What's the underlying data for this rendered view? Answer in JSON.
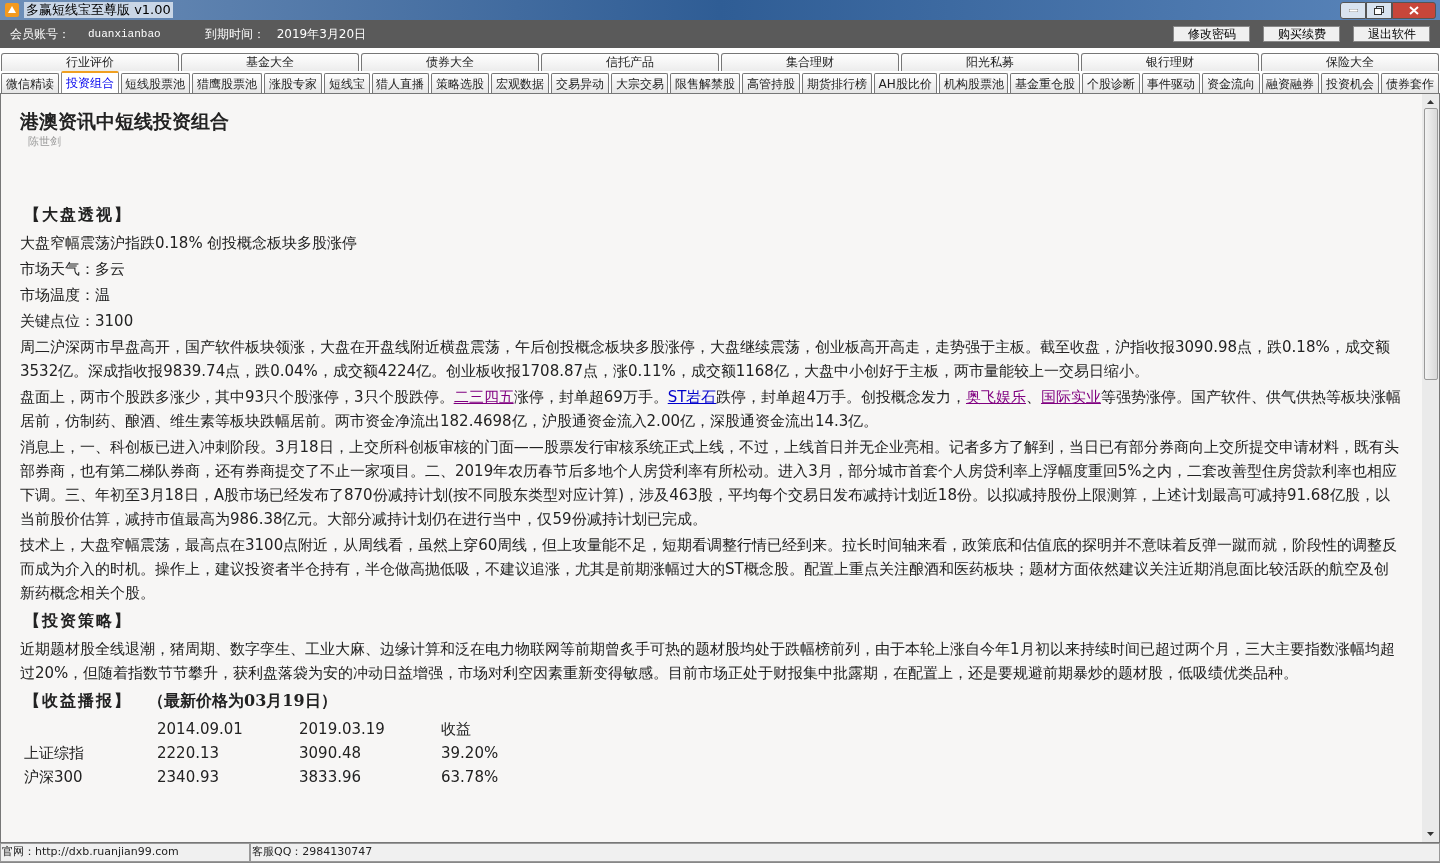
{
  "window": {
    "title": "多赢短线宝至尊版 v1.00"
  },
  "account_bar": {
    "account_label": "会员账号：",
    "account": "duanxianbao",
    "expiry_label": "到期时间：",
    "expiry": "2019年3月20日",
    "buttons": [
      "修改密码",
      "购买续费",
      "退出软件"
    ]
  },
  "categories": [
    "行业评价",
    "基金大全",
    "债券大全",
    "信托产品",
    "集合理财",
    "阳光私募",
    "银行理财",
    "保险大全"
  ],
  "tabs": [
    {
      "label": "微信精读",
      "selected": false
    },
    {
      "label": "投资组合",
      "selected": true
    },
    {
      "label": "短线股票池",
      "selected": false
    },
    {
      "label": "猎鹰股票池",
      "selected": false
    },
    {
      "label": "涨股专家",
      "selected": false
    },
    {
      "label": "短线宝",
      "selected": false
    },
    {
      "label": "猎人直播",
      "selected": false
    },
    {
      "label": "策略选股",
      "selected": false
    },
    {
      "label": "宏观数据",
      "selected": false
    },
    {
      "label": "交易异动",
      "selected": false
    },
    {
      "label": "大宗交易",
      "selected": false
    },
    {
      "label": "限售解禁股",
      "selected": false
    },
    {
      "label": "高管持股",
      "selected": false
    },
    {
      "label": "期货排行榜",
      "selected": false
    },
    {
      "label": "AH股比价",
      "selected": false
    },
    {
      "label": "机构股票池",
      "selected": false
    },
    {
      "label": "基金重仓股",
      "selected": false
    },
    {
      "label": "个股诊断",
      "selected": false
    },
    {
      "label": "事件驱动",
      "selected": false
    },
    {
      "label": "资金流向",
      "selected": false
    },
    {
      "label": "融资融券",
      "selected": false
    },
    {
      "label": "投资机会",
      "selected": false
    },
    {
      "label": "债券套作",
      "selected": false
    }
  ],
  "article": {
    "title": "港澳资讯中短线投资组合",
    "author": "陈世剑",
    "blocks": [
      {
        "kind": "heading",
        "text": "【大盘透视】"
      },
      {
        "kind": "line",
        "text": "大盘窄幅震荡沪指跌0.18% 创投概念板块多股涨停"
      },
      {
        "kind": "line",
        "text": "市场天气：多云"
      },
      {
        "kind": "line",
        "text": "市场温度：温"
      },
      {
        "kind": "line",
        "text": "关键点位：3100"
      },
      {
        "kind": "paragraph",
        "segments": [
          {
            "kind": "text",
            "text": "周二沪深两市早盘高开，国产软件板块领涨，大盘在开盘线附近横盘震荡，午后创投概念板块多股涨停，大盘继续震荡，创业板高开高走，走势强于主板。截至收盘，沪指收报3090.98点，跌0.18%，成交额3532亿。深成指收报9839.74点，跌0.04%，成交额4224亿。创业板收报1708.87点，涨0.11%，成交额1168亿，大盘中小创好于主板，两市量能较上一交易日缩小。"
          }
        ]
      },
      {
        "kind": "paragraph",
        "segments": [
          {
            "kind": "text",
            "text": "盘面上，两市个股跌多涨少，其中93只个股涨停，3只个股跌停。"
          },
          {
            "kind": "link",
            "text": "二三四五",
            "visited": true
          },
          {
            "kind": "text",
            "text": "涨停，封单超69万手。"
          },
          {
            "kind": "link",
            "text": "ST岩石",
            "visited": false
          },
          {
            "kind": "text",
            "text": "跌停，封单超4万手。创投概念发力，"
          },
          {
            "kind": "link",
            "text": "奥飞娱乐",
            "visited": true
          },
          {
            "kind": "text",
            "text": "、"
          },
          {
            "kind": "link",
            "text": "国际实业",
            "visited": true
          },
          {
            "kind": "text",
            "text": "等强势涨停。国产软件、供气供热等板块涨幅居前，仿制药、酿酒、维生素等板块跌幅居前。两市资金净流出182.4698亿，沪股通资金流入2.00亿，深股通资金流出14.3亿。"
          }
        ]
      },
      {
        "kind": "paragraph",
        "segments": [
          {
            "kind": "text",
            "text": "消息上，一、科创板已进入冲刺阶段。3月18日，上交所科创板审核的门面——股票发行审核系统正式上线，不过，上线首日并无企业亮相。记者多方了解到，当日已有部分券商向上交所提交申请材料，既有头部券商，也有第二梯队券商，还有券商提交了不止一家项目。二、2019年农历春节后多地个人房贷利率有所松动。进入3月，部分城市首套个人房贷利率上浮幅度重回5%之内，二套改善型住房贷款利率也相应下调。三、年初至3月18日，A股市场已经发布了870份减持计划(按不同股东类型对应计算)，涉及463股，平均每个交易日发布减持计划近18份。以拟减持股份上限测算，上述计划最高可减持91.68亿股，以当前股价估算，减持市值最高为986.38亿元。大部分减持计划仍在进行当中，仅59份减持计划已完成。"
          }
        ]
      },
      {
        "kind": "paragraph",
        "segments": [
          {
            "kind": "text",
            "text": "技术上，大盘窄幅震荡，最高点在3100点附近，从周线看，虽然上穿60周线，但上攻量能不足，短期看调整行情已经到来。拉长时间轴来看，政策底和估值底的探明并不意味着反弹一蹴而就，阶段性的调整反而成为介入的时机。操作上，建议投资者半仓持有，半仓做高抛低吸，不建议追涨，尤其是前期涨幅过大的ST概念股。配置上重点关注酿酒和医药板块；题材方面依然建议关注近期消息面比较活跃的航空及创新药概念相关个股。"
          }
        ]
      },
      {
        "kind": "heading",
        "text": "【投资策略】"
      },
      {
        "kind": "paragraph",
        "segments": [
          {
            "kind": "text",
            "text": "近期题材股全线退潮，猪周期、数字孪生、工业大麻、边缘计算和泛在电力物联网等前期曾炙手可热的题材股均处于跌幅榜前列，由于本轮上涨自今年1月初以来持续时间已超过两个月，三大主要指数涨幅均超过20%，但随着指数节节攀升，获利盘落袋为安的冲动日益增强，市场对利空因素重新变得敏感。目前市场正处于财报集中批露期，在配置上，还是要规避前期暴炒的题材股，低吸绩优类品种。"
          }
        ]
      },
      {
        "kind": "heading",
        "text": "【收益播报】",
        "note": "（最新价格为03月19日）"
      },
      {
        "kind": "table",
        "columns": [
          "2014.09.01",
          "2019.03.19",
          "收益"
        ],
        "rows": [
          {
            "name": "上证综指",
            "cells": [
              "2220.13",
              "3090.48",
              "39.20%"
            ]
          },
          {
            "name": "沪深300",
            "cells": [
              "2340.93",
              "3833.96",
              "63.78%"
            ]
          }
        ]
      }
    ]
  },
  "status_bar": [
    "官网：http://dxb.ruanjian99.com",
    "客服QQ：2984130747"
  ]
}
